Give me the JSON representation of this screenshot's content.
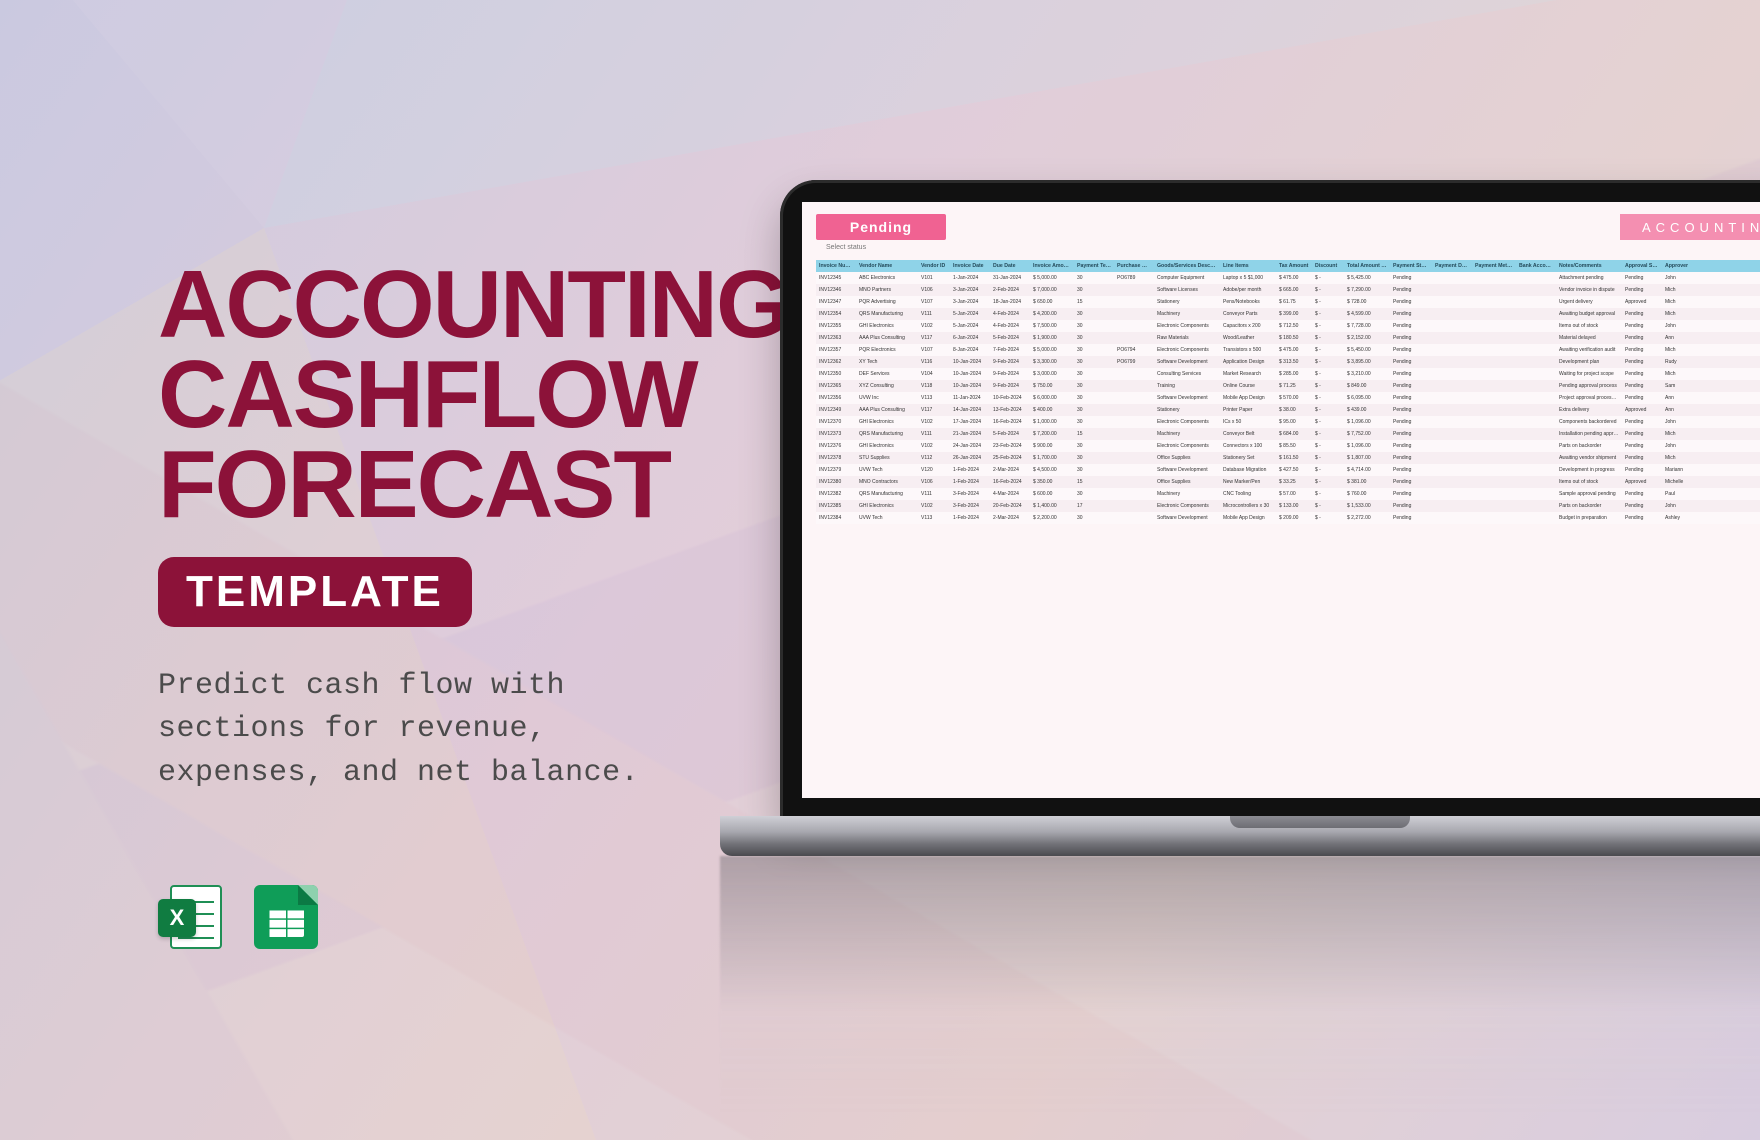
{
  "hero": {
    "title_l1": "ACCOUNTING",
    "title_l2": "CASHFLOW",
    "title_l3": "FORECAST",
    "pill": "TEMPLATE",
    "desc": "Predict cash flow with sections for revenue, expenses, and net balance."
  },
  "apps": {
    "excel_label": "X",
    "excel_name": "Microsoft Excel",
    "sheets_name": "Google Sheets"
  },
  "sheet": {
    "status_badge": "Pending",
    "sublabel": "Select status",
    "banner": "ACCOUNTING C",
    "headers": [
      "Invoice Number",
      "Vendor Name",
      "Vendor ID",
      "Invoice Date",
      "Due Date",
      "Invoice Amount",
      "Payment Terms (Days)",
      "Purchase Order",
      "Goods/Services Description",
      "Line Items",
      "Tax Amount",
      "Discount",
      "Total Amount Due",
      "Payment Status",
      "Payment Date",
      "Payment Method",
      "Bank Account",
      "Notes/Comments",
      "Approval Status",
      "Approver"
    ],
    "rows": [
      [
        "INV12345",
        "ABC Electronics",
        "V101",
        "1-Jan-2024",
        "31-Jan-2024",
        "$ 5,000.00",
        "30",
        "PO6789",
        "Computer Equipment",
        "Laptop x 5 $1,000",
        "$ 475.00",
        "$ -",
        "$ 5,425.00",
        "Pending",
        "",
        "",
        "",
        "Attachment pending",
        "Pending",
        "John"
      ],
      [
        "INV12346",
        "MNO Partners",
        "V106",
        "3-Jan-2024",
        "2-Feb-2024",
        "$ 7,000.00",
        "30",
        "",
        "Software Licenses",
        "Adobe/per month",
        "$ 665.00",
        "$ -",
        "$ 7,290.00",
        "Pending",
        "",
        "",
        "",
        "Vendor invoice in dispute",
        "Pending",
        "Mich"
      ],
      [
        "INV12347",
        "PQR Advertising",
        "V107",
        "3-Jan-2024",
        "18-Jan-2024",
        "$ 650.00",
        "15",
        "",
        "Stationery",
        "Pens/Notebooks",
        "$ 61.75",
        "$ -",
        "$ 728.00",
        "Pending",
        "",
        "",
        "",
        "Urgent delivery",
        "Approved",
        "Mich"
      ],
      [
        "INV12354",
        "QRS Manufacturing",
        "V111",
        "5-Jan-2024",
        "4-Feb-2024",
        "$ 4,200.00",
        "30",
        "",
        "Machinery",
        "Conveyor Parts",
        "$ 399.00",
        "$ -",
        "$ 4,599.00",
        "Pending",
        "",
        "",
        "",
        "Awaiting budget approval",
        "Pending",
        "Mich"
      ],
      [
        "INV12355",
        "GHI Electronics",
        "V102",
        "5-Jan-2024",
        "4-Feb-2024",
        "$ 7,500.00",
        "30",
        "",
        "Electronic Components",
        "Capacitors x 200",
        "$ 712.50",
        "$ -",
        "$ 7,728.00",
        "Pending",
        "",
        "",
        "",
        "Items out of stock",
        "Pending",
        "John"
      ],
      [
        "INV12363",
        "AAA Plus Consulting",
        "V117",
        "6-Jan-2024",
        "5-Feb-2024",
        "$ 1,900.00",
        "30",
        "",
        "Raw Materials",
        "Wood/Leather",
        "$ 180.50",
        "$ -",
        "$ 2,152.00",
        "Pending",
        "",
        "",
        "",
        "Material delayed",
        "Pending",
        "Ann"
      ],
      [
        "INV12357",
        "PQR Electronics",
        "V107",
        "8-Jan-2024",
        "7-Feb-2024",
        "$ 5,000.00",
        "30",
        "PO6794",
        "Electronic Components",
        "Transistors x 500",
        "$ 475.00",
        "$ -",
        "$ 5,450.00",
        "Pending",
        "",
        "",
        "",
        "Awaiting verification audit",
        "Pending",
        "Mich"
      ],
      [
        "INV12362",
        "XY Tech",
        "V116",
        "10-Jan-2024",
        "9-Feb-2024",
        "$ 3,300.00",
        "30",
        "PO6799",
        "Software Development",
        "Application Design",
        "$ 313.50",
        "$ -",
        "$ 3,895.00",
        "Pending",
        "",
        "",
        "",
        "Development plan",
        "Pending",
        "Rudy"
      ],
      [
        "INV12350",
        "DEF Services",
        "V104",
        "10-Jan-2024",
        "9-Feb-2024",
        "$ 3,000.00",
        "30",
        "",
        "Consulting Services",
        "Market Research",
        "$ 285.00",
        "$ -",
        "$ 3,210.00",
        "Pending",
        "",
        "",
        "",
        "Waiting for project scope",
        "Pending",
        "Mich"
      ],
      [
        "INV12365",
        "XYZ Consulting",
        "V118",
        "10-Jan-2024",
        "9-Feb-2024",
        "$ 750.00",
        "30",
        "",
        "Training",
        "Online Course",
        "$ 71.25",
        "$ -",
        "$ 849.00",
        "Pending",
        "",
        "",
        "",
        "Pending approval process",
        "Pending",
        "Sam"
      ],
      [
        "INV12356",
        "UVW Inc",
        "V113",
        "11-Jan-2024",
        "10-Feb-2024",
        "$ 6,000.00",
        "30",
        "",
        "Software Development",
        "Mobile App Design",
        "$ 570.00",
        "$ -",
        "$ 6,095.00",
        "Pending",
        "",
        "",
        "",
        "Project approval processed",
        "Pending",
        "Ann"
      ],
      [
        "INV12349",
        "AAA Plus Consulting",
        "V117",
        "14-Jan-2024",
        "13-Feb-2024",
        "$ 400.00",
        "30",
        "",
        "Stationery",
        "Printer Paper",
        "$ 38.00",
        "$ -",
        "$ 439.00",
        "Pending",
        "",
        "",
        "",
        "Extra delivery",
        "Approved",
        "Ann"
      ],
      [
        "INV12370",
        "GHI Electronics",
        "V102",
        "17-Jan-2024",
        "16-Feb-2024",
        "$ 1,000.00",
        "30",
        "",
        "Electronic Components",
        "ICs x 50",
        "$ 95.00",
        "$ -",
        "$ 1,096.00",
        "Pending",
        "",
        "",
        "",
        "Components backordered",
        "Pending",
        "John"
      ],
      [
        "INV12373",
        "QRS Manufacturing",
        "V111",
        "21-Jan-2024",
        "5-Feb-2024",
        "$ 7,200.00",
        "15",
        "",
        "Machinery",
        "Conveyor Belt",
        "$ 684.00",
        "$ -",
        "$ 7,752.00",
        "Pending",
        "",
        "",
        "",
        "Installation pending approval",
        "Pending",
        "Mich"
      ],
      [
        "INV12376",
        "GHI Electronics",
        "V102",
        "24-Jan-2024",
        "23-Feb-2024",
        "$ 900.00",
        "30",
        "",
        "Electronic Components",
        "Connectors x 100",
        "$ 85.50",
        "$ -",
        "$ 1,096.00",
        "Pending",
        "",
        "",
        "",
        "Parts on backorder",
        "Pending",
        "John"
      ],
      [
        "INV12378",
        "STU Supplies",
        "V112",
        "26-Jan-2024",
        "25-Feb-2024",
        "$ 1,700.00",
        "30",
        "",
        "Office Supplies",
        "Stationery Set",
        "$ 161.50",
        "$ -",
        "$ 1,807.00",
        "Pending",
        "",
        "",
        "",
        "Awaiting vendor shipment",
        "Pending",
        "Mich"
      ],
      [
        "INV12379",
        "UVW Tech",
        "V120",
        "1-Feb-2024",
        "2-Mar-2024",
        "$ 4,500.00",
        "30",
        "",
        "Software Development",
        "Database Migration",
        "$ 427.50",
        "$ -",
        "$ 4,714.00",
        "Pending",
        "",
        "",
        "",
        "Development in progress",
        "Pending",
        "Mariann"
      ],
      [
        "INV12380",
        "MNO Contractors",
        "V106",
        "1-Feb-2024",
        "16-Feb-2024",
        "$ 350.00",
        "15",
        "",
        "Office Supplies",
        "New Marker/Pen",
        "$ 33.25",
        "$ -",
        "$ 381.00",
        "Pending",
        "",
        "",
        "",
        "Items out of stock",
        "Approved",
        "Michelle"
      ],
      [
        "INV12382",
        "QRS Manufacturing",
        "V111",
        "3-Feb-2024",
        "4-Mar-2024",
        "$ 600.00",
        "30",
        "",
        "Machinery",
        "CNC Tooling",
        "$ 57.00",
        "$ -",
        "$ 760.00",
        "Pending",
        "",
        "",
        "",
        "Sample approval pending",
        "Pending",
        "Paul"
      ],
      [
        "INV12385",
        "GHI Electronics",
        "V102",
        "3-Feb-2024",
        "20-Feb-2024",
        "$ 1,400.00",
        "17",
        "",
        "Electronic Components",
        "Microcontrollers x 30",
        "$ 133.00",
        "$ -",
        "$ 1,533.00",
        "Pending",
        "",
        "",
        "",
        "Parts on backorder",
        "Pending",
        "John"
      ],
      [
        "INV12384",
        "UVW Tech",
        "V113",
        "1-Feb-2024",
        "2-Mar-2024",
        "$ 2,200.00",
        "30",
        "",
        "Software Development",
        "Mobile App Design",
        "$ 209.00",
        "$ -",
        "$ 2,272.00",
        "Pending",
        "",
        "",
        "",
        "Budget in preparation",
        "Pending",
        "Ashley"
      ]
    ]
  }
}
